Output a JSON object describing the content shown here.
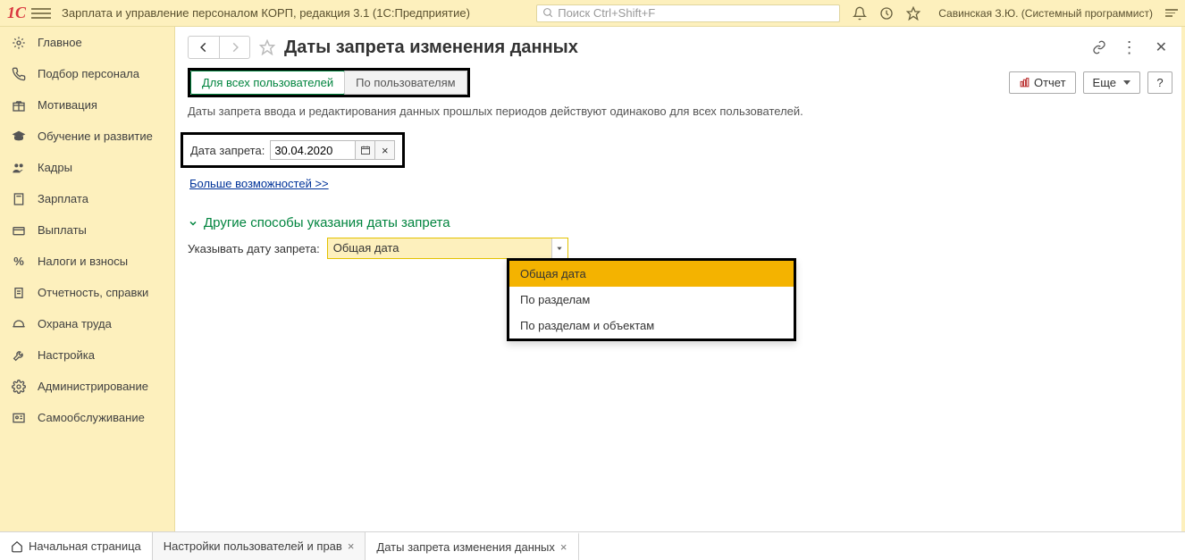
{
  "titlebar": {
    "app_title": "Зарплата и управление персоналом КОРП, редакция 3.1  (1С:Предприятие)",
    "search_placeholder": "Поиск Ctrl+Shift+F",
    "username": "Савинская З.Ю. (Системный программист)"
  },
  "sidebar": {
    "items": [
      {
        "label": "Главное"
      },
      {
        "label": "Подбор персонала"
      },
      {
        "label": "Мотивация"
      },
      {
        "label": "Обучение и развитие"
      },
      {
        "label": "Кадры"
      },
      {
        "label": "Зарплата"
      },
      {
        "label": "Выплаты"
      },
      {
        "label": "Налоги и взносы"
      },
      {
        "label": "Отчетность, справки"
      },
      {
        "label": "Охрана труда"
      },
      {
        "label": "Настройка"
      },
      {
        "label": "Администрирование"
      },
      {
        "label": "Самообслуживание"
      }
    ]
  },
  "page": {
    "title": "Даты запрета изменения данных",
    "tabs": {
      "all_users": "Для всех пользователей",
      "by_users": "По пользователям"
    },
    "toolbar": {
      "report": "Отчет",
      "more": "Еще",
      "help": "?"
    },
    "description": "Даты запрета ввода и редактирования данных прошлых периодов действуют одинаково для всех пользователей.",
    "date_label": "Дата запрета:",
    "date_value": "30.04.2020",
    "more_link": "Больше возможностей >>",
    "expander_title": "Другие способы указания даты запрета",
    "dropdown_label": "Указывать дату запрета:",
    "dropdown_value": "Общая дата",
    "dropdown_options": [
      "Общая дата",
      "По разделам",
      "По разделам и объектам"
    ]
  },
  "bottom": {
    "tabs": [
      {
        "label": "Начальная страница",
        "closable": false,
        "home": true
      },
      {
        "label": "Настройки пользователей и прав",
        "closable": true
      },
      {
        "label": "Даты запрета изменения данных",
        "closable": true,
        "active": true
      }
    ]
  }
}
